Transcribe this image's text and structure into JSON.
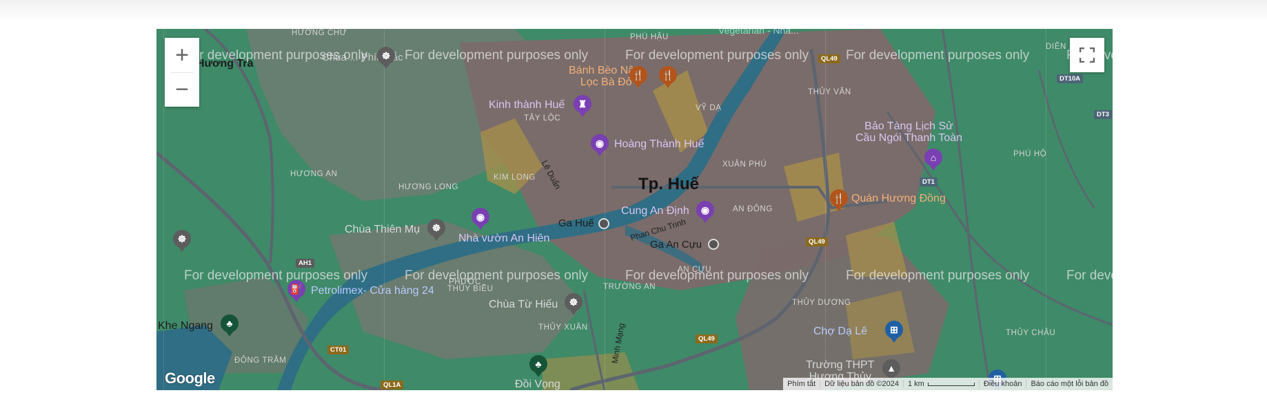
{
  "map": {
    "watermark": "For development purposes only",
    "city_label": "Tp. Huế",
    "districts": [
      {
        "id": "huong-chu",
        "name": "HƯƠNG CHỮ"
      },
      {
        "id": "phu-hau",
        "name": "PHÚ HẬU"
      },
      {
        "id": "tay-loc",
        "name": "TÂY LỘC"
      },
      {
        "id": "vy-da",
        "name": "VỸ DẠ"
      },
      {
        "id": "thuy-van",
        "name": "THỦY VÂN"
      },
      {
        "id": "huong-an",
        "name": "HƯƠNG AN"
      },
      {
        "id": "kim-long",
        "name": "KIM LONG"
      },
      {
        "id": "huong-long",
        "name": "HƯƠNG LONG"
      },
      {
        "id": "xuan-phu",
        "name": "XUÂN PHÚ"
      },
      {
        "id": "an-dong",
        "name": "AN ĐÔNG"
      },
      {
        "id": "phu-hoi",
        "name": "PHÚ HỘ"
      },
      {
        "id": "an-cuu",
        "name": "AN CỰU"
      },
      {
        "id": "phuoc",
        "name": "PHƯỚC"
      },
      {
        "id": "thuy-bieu",
        "name": "THỦY BIỀU"
      },
      {
        "id": "truong-an",
        "name": "TRƯỜNG AN"
      },
      {
        "id": "thuy-duong",
        "name": "THỦY DƯƠNG"
      },
      {
        "id": "thuy-xuan",
        "name": "THỦY XUÂN"
      },
      {
        "id": "thuy-chau",
        "name": "THỦY CHÂU"
      },
      {
        "id": "dong-tram",
        "name": "ĐÔNG TRĂM"
      },
      {
        "id": "dien",
        "name": "DIÊN"
      }
    ],
    "places": [
      {
        "id": "huong-tra",
        "name": "Hương Trà"
      },
      {
        "id": "chua-phia-bac",
        "name": "Chùa ... Phía Bắc"
      },
      {
        "id": "banh-beo",
        "name": "Bánh Bèo Nậm\nLọc Bà Đỏ"
      },
      {
        "id": "vegetarian",
        "name": "Vegetarian - Nha..."
      },
      {
        "id": "kinh-thanh",
        "name": "Kinh thành Huế"
      },
      {
        "id": "hoang-thanh",
        "name": "Hoàng Thành Huế"
      },
      {
        "id": "bao-tang",
        "name": "Bảo Tàng Lịch Sử\nCầu Ngói Thanh Toàn"
      },
      {
        "id": "quan-huong-dong",
        "name": "Quán Hương Đồng"
      },
      {
        "id": "cung-an-dinh",
        "name": "Cung An Định"
      },
      {
        "id": "ga-hue",
        "name": "Ga Huế"
      },
      {
        "id": "ga-an-cuu",
        "name": "Ga An Cựu"
      },
      {
        "id": "chua-thien-mu",
        "name": "Chùa Thiên Mụ"
      },
      {
        "id": "nha-vuon",
        "name": "Nhà vườn An Hiên"
      },
      {
        "id": "petrolimex",
        "name": "Petrolimex- Cửa hàng 24"
      },
      {
        "id": "chua-tu-hieu",
        "name": "Chùa Từ Hiếu"
      },
      {
        "id": "khe-ngang",
        "name": "Khe Ngang"
      },
      {
        "id": "cho-da-le",
        "name": "Chợ Dạ Lê"
      },
      {
        "id": "truong-thpt",
        "name": "Trường THPT\nHương Thủy"
      },
      {
        "id": "doi-vong",
        "name": "Đồi Vọng"
      }
    ],
    "streets": [
      {
        "id": "le-duan",
        "name": "Lê Duẩn"
      },
      {
        "id": "phan-chu-trinh",
        "name": "Phan Chu Trinh"
      },
      {
        "id": "minh-mang",
        "name": "Minh Mạng"
      }
    ],
    "road_shields": [
      {
        "id": "ql49-top",
        "code": "QL49"
      },
      {
        "id": "dt10a",
        "code": "DT10A"
      },
      {
        "id": "dt3",
        "code": "DT3"
      },
      {
        "id": "dt1",
        "code": "DT1"
      },
      {
        "id": "ql49-mid",
        "code": "QL49"
      },
      {
        "id": "ah1",
        "code": "AH1"
      },
      {
        "id": "ct01",
        "code": "CT01"
      },
      {
        "id": "ql49-bottom",
        "code": "QL49"
      },
      {
        "id": "ql1a",
        "code": "QL1A"
      }
    ],
    "colors": {
      "land": "#3f8a68",
      "urban": "#7a6c6a",
      "river": "#2f6e84",
      "highway": "#5d6470",
      "sand": "#a9904a"
    }
  },
  "controls": {
    "zoom_in_label": "+",
    "zoom_out_label": "−",
    "fullscreen_icon": "fullscreen-icon"
  },
  "logo": "Google",
  "attribution": {
    "shortcuts": "Phím tắt",
    "map_data": "Dữ liệu bản đồ ©2024",
    "scale_label": "1 km",
    "terms": "Điều khoản",
    "report": "Báo cáo một lỗi bản đồ"
  }
}
